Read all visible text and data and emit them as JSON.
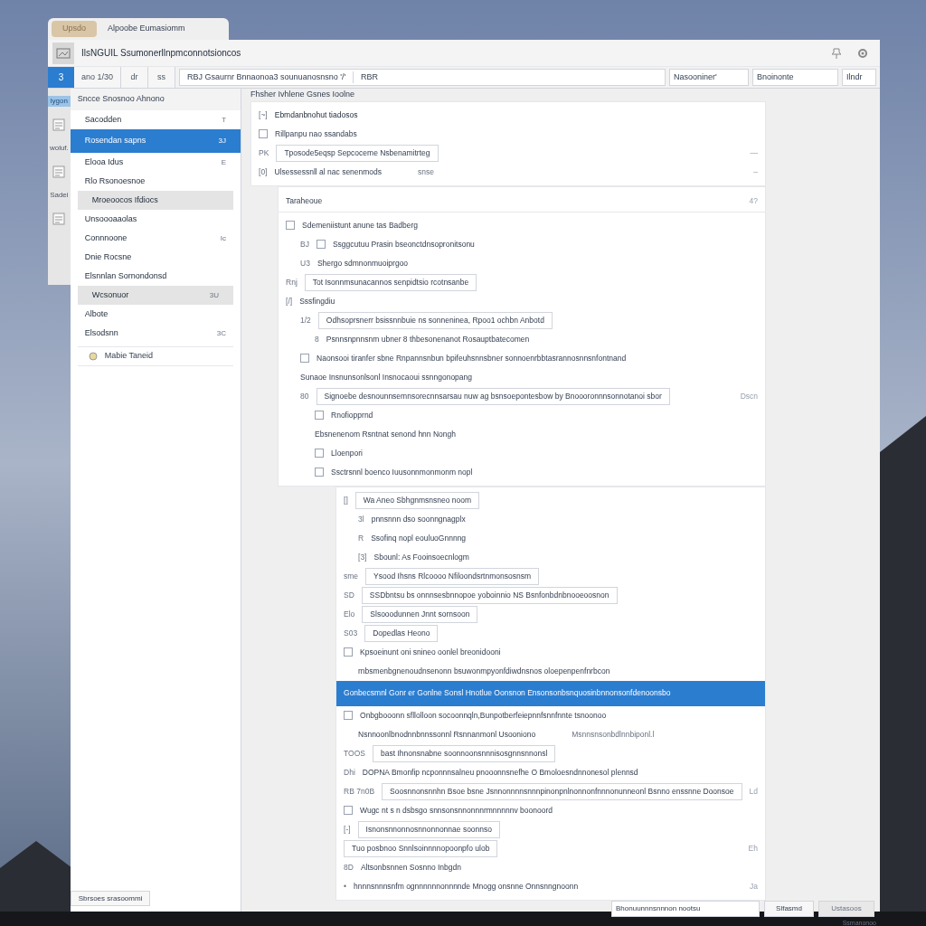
{
  "back_tab": {
    "badge": "Upsdo",
    "title": "Alpoobe Eumasiomm"
  },
  "window": {
    "title": "IlsNGUIL Ssumonerllnpmconnotsioncos"
  },
  "toolbar": {
    "badge": "3",
    "buttons": [
      "ano 1/30",
      "dr",
      "ss"
    ],
    "address": "RBJ  Gsaurnr Bnnaonoa3 sounuanosnsno '/'",
    "address_end": "RBR",
    "fields": [
      "Nasooniner'",
      "Bnoinonte",
      "Ilndr"
    ]
  },
  "rail": {
    "items": [
      {
        "label": "lygon",
        "selected": true
      },
      {
        "label": "woluf.",
        "selected": false
      },
      {
        "label": "Sadei",
        "selected": false
      }
    ]
  },
  "sidebar": {
    "header": "Sncce  Snosnoo  Ahnono",
    "items": [
      {
        "label": "Sacodden",
        "shortcut": "T",
        "selected": false,
        "highlighted": false
      },
      {
        "label": "Rosendan sapns",
        "shortcut": "3J",
        "selected": true,
        "highlighted": false
      },
      {
        "label": "Elooa Idus",
        "shortcut": "E",
        "selected": false,
        "highlighted": false
      },
      {
        "label": "Rlo Rsonoesnoe",
        "selected": false,
        "highlighted": false
      },
      {
        "label": "Mroeoocos Ifdiocs",
        "selected": false,
        "highlighted": true
      },
      {
        "label": "Unsoooaaolas",
        "selected": false,
        "highlighted": false
      },
      {
        "label": "Connnoone",
        "shortcut": "Ic",
        "selected": false,
        "highlighted": false
      },
      {
        "label": "Dnie Rocsne",
        "selected": false,
        "highlighted": false
      },
      {
        "label": "Elsnnlan Sornondonsd",
        "selected": false,
        "highlighted": false
      },
      {
        "label": "Wcsonuor",
        "shortcut": "3U",
        "selected": false,
        "highlighted": true
      },
      {
        "label": "Albote",
        "selected": false,
        "highlighted": false
      },
      {
        "label": "Elsodsnn",
        "shortcut": "3C",
        "selected": false,
        "highlighted": false
      }
    ],
    "footer_link": "Mabie Taneid",
    "bottom_button": "Sbrsoes srasoommi"
  },
  "content": {
    "title": "Fhsher Ivhlene Gsnes Ioolne",
    "cards": [
      {
        "rows": [
          {
            "kind": "title",
            "prefix": "[~]",
            "label": "Ebmdanbnohut tiadosos"
          },
          {
            "kind": "checkbox",
            "label": "Rillpanpu nao ssandabs",
            "checked": false
          },
          {
            "kind": "field",
            "prefix": "PK",
            "label": "Tposode5eqsp Sepcoceme Nsbenamitrteg",
            "trailing": "—"
          },
          {
            "kind": "text",
            "prefix": "[0]",
            "label": "Ulsessessnll al nac senenmods",
            "note": "snse",
            "trailing": "–"
          }
        ]
      },
      {
        "header": "Taraheoue",
        "header_trailing": "4?",
        "rows": [
          {
            "kind": "checkbox",
            "label": "Sdemeniistunt anune tas Badberg",
            "checked": false,
            "children": [
              {
                "kind": "checkbox",
                "prefix": "BJ",
                "label": "Ssggcutuu Prasin bseonctdnsopronitsonu",
                "checked": false
              },
              {
                "kind": "text",
                "prefix": "U3",
                "label": "Shergo sdmnonmuoiprgoo"
              }
            ]
          },
          {
            "kind": "field",
            "prefix": "Rnj",
            "label": "Tot Isonnmsunacannos senpidtsio rcotnsanbe"
          },
          {
            "kind": "text",
            "prefix": "[/]",
            "label": "Sssfingdiu",
            "children": [
              {
                "kind": "field",
                "prefix": "1/2",
                "label": "Odhsoprsnerr bsissnnbuie ns sonneninea, Rpoo1 ochbn Anbotd",
                "children": [
                  {
                    "kind": "text",
                    "prefix": "8",
                    "label": "Psnnsnpnnsnm ubner 8 thbesonenanot Rosauptbatecomen"
                  }
                ]
              },
              {
                "kind": "checkbox",
                "label": "Naonsooi tiranfer sbne Rnpannsnbun bpifeuhsnnsbner sonnoenrbbtasrannosnnsnfontnand",
                "checked": false
              },
              {
                "kind": "text",
                "label": "Sunaoe Insnunsonlsonl Insnocaoui ssnngonopang"
              },
              {
                "kind": "field",
                "prefix": "80",
                "label": "Signoebe desnounnsemnsorecnnsarsau nuw ag bsnsoepontesbow by Bnoooronnnsonnotanoi sbor",
                "trailing": "Dscn",
                "children": [
                  {
                    "kind": "checkbox",
                    "label": "Rnofiopprnd",
                    "checked": false
                  },
                  {
                    "kind": "text",
                    "label": "Ebsnenenom Rsntnat senond hnn Nongh"
                  },
                  {
                    "kind": "checkbox",
                    "label": "Lloenpori",
                    "checked": false
                  },
                  {
                    "kind": "checkbox",
                    "label": "Ssctrsnnl boenco Iuusonnmonmonm nopl",
                    "checked": false
                  }
                ]
              }
            ]
          }
        ]
      },
      {
        "rows": [
          {
            "kind": "field",
            "prefix": "[]",
            "label": "Wa Aneo Sbhgnmsnsneo noom",
            "children": [
              {
                "kind": "text",
                "prefix": "3l",
                "label": "pnnsnnn dso soonngnagplx"
              },
              {
                "kind": "text",
                "prefix": "R",
                "label": "Ssofinq nopl eouluoGnnnng"
              },
              {
                "kind": "text",
                "prefix": "[3]",
                "label": "Sbounl: As Fooinsoecnlogm"
              }
            ]
          },
          {
            "kind": "field",
            "prefix": "sme",
            "label": "Ysood Ihsns Rlcoooo Nfiloondsrtnmonsosnsm"
          },
          {
            "kind": "field",
            "prefix": "SD",
            "label": "SSDbntsu bs onnnsesbnnopoe yoboinnio NS Bsnfonbdnbnooeoosnon"
          },
          {
            "kind": "field",
            "prefix": "Elo",
            "label": "Slsooodunnen Jnnt sornsoon"
          },
          {
            "kind": "field",
            "prefix": "S03",
            "label": "Dopedlas Heono"
          },
          {
            "kind": "checkbox",
            "label": "Kpsoeinunt oni snineo oonlel breonidooni",
            "checked": false,
            "children": [
              {
                "kind": "text",
                "label": "rnbsmenbgnenoudnsenonn bsuwonmpyonfdiwdnsnos oloepenpenfnrbcon"
              }
            ]
          },
          {
            "kind": "highlight",
            "label": "Gonbecsmnl Gonr er Gonlne Sonsl Hnotlue Oonsnon Ensonsonbsnquosinbnnonsonfdenoonsbo"
          },
          {
            "kind": "checkbox",
            "label": "Onbgbooonn sfllolloon socoonnqln,Bunpotberfeiepnnfsnnfnnte tsnoonoo",
            "checked": false,
            "children": [
              {
                "kind": "text",
                "label": "Nsnnoonlbnodnnbnnssonnl  Rsnnanmonl Usooniono",
                "note": "Msnnsnsonbdlnnbiponl.l"
              }
            ]
          },
          {
            "kind": "field",
            "prefix": "TOOS",
            "label": "bast Ihnonsnabne  soonnoonsnnnisosgnnsnnonsl"
          },
          {
            "kind": "text",
            "prefix": "Dhi",
            "label": "DOPNA Bmonfip ncponnnsalneu pnooonnsnefhe O Bmoloesndnnonesol plennsd"
          },
          {
            "kind": "field",
            "prefix": "RB 7n0B",
            "label": "Soosnnonsnnhn Bsoe bsne  Jsnnonnnnsnnnpinonpnlnonnonfnnnonunneonl Bsnno enssnne Doonsoe",
            "trailing": "Ld"
          },
          {
            "kind": "checkbox",
            "label": "Wugc nt s n dsbsgo snnsonsnnonnnrmnnnnnv boonoord",
            "checked": false
          },
          {
            "kind": "field",
            "prefix": "[-]",
            "label": "Isnonsnnonnosnnonnonnae soonnso"
          },
          {
            "kind": "field",
            "label": "Tuo posbnoo Snnlsoinnnnopoonpfo ulob",
            "trailing": "Eh"
          },
          {
            "kind": "text",
            "prefix": "8D",
            "label": "Altsonbsnnen Sosnno Inbgdn"
          },
          {
            "kind": "text",
            "prefix": "•",
            "label": "hnnnsnnnsnfm ognnnnnnonnnnde Mnogg onsnne Onnsnngnoonn",
            "trailing": "Ja"
          }
        ]
      }
    ],
    "corner_label": "Ssmanonoo",
    "footer_field": "Bhonuunnnsnnnon nootsu",
    "footer_buttons": [
      {
        "label": "Slfasmd",
        "disabled": false
      },
      {
        "label": "Ustasoos",
        "disabled": true
      }
    ]
  }
}
